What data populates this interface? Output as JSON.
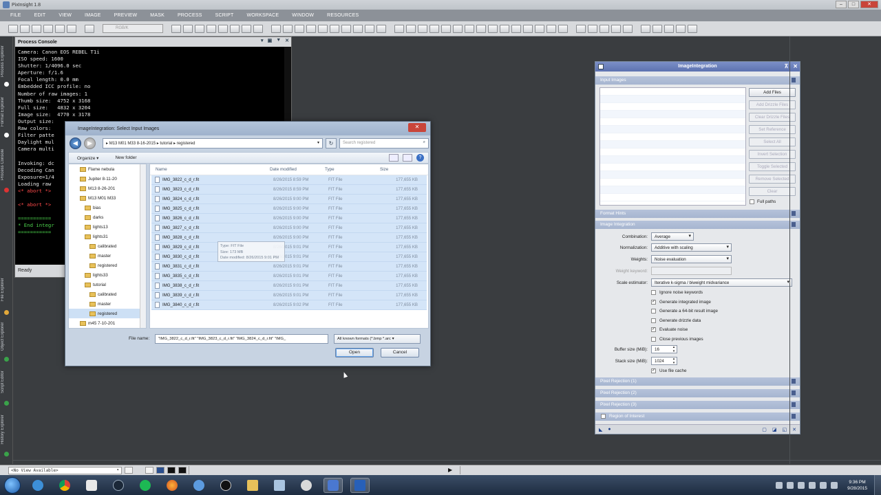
{
  "window": {
    "title": "PixInsight 1.8"
  },
  "menu": [
    "FILE",
    "EDIT",
    "VIEW",
    "IMAGE",
    "PREVIEW",
    "MASK",
    "PROCESS",
    "SCRIPT",
    "WORKSPACE",
    "WINDOW",
    "RESOURCES"
  ],
  "toolbar": {
    "combo_placeholder": "RGB/K"
  },
  "left_tabs": [
    "Process Explorer",
    "Format Explorer",
    "Process Console",
    "File Explorer",
    "Object Explorer",
    "Script Editor",
    "History Explorer"
  ],
  "console": {
    "title": "Process Console",
    "status": "Ready",
    "lines": [
      {
        "t": "Camera: Canon EOS REBEL T1i",
        "c": ""
      },
      {
        "t": "ISO speed: 1600",
        "c": ""
      },
      {
        "t": "Shutter: 1/4096.0 sec",
        "c": ""
      },
      {
        "t": "Aperture: f/1.6",
        "c": ""
      },
      {
        "t": "Focal length: 0.0 mm",
        "c": ""
      },
      {
        "t": "Embedded ICC profile: no",
        "c": ""
      },
      {
        "t": "Number of raw images: 1",
        "c": ""
      },
      {
        "t": "Thumb size:  4752 x 3168",
        "c": ""
      },
      {
        "t": "Full size:   4832 x 3204",
        "c": ""
      },
      {
        "t": "Image size:  4770 x 3178",
        "c": ""
      },
      {
        "t": "Output size:",
        "c": ""
      },
      {
        "t": "Raw colors:",
        "c": ""
      },
      {
        "t": "Filter patte",
        "c": ""
      },
      {
        "t": "Daylight mul",
        "c": ""
      },
      {
        "t": "Camera multi",
        "c": ""
      },
      {
        "t": "",
        "c": ""
      },
      {
        "t": "Invoking: dc",
        "c": ""
      },
      {
        "t": "Decoding Can",
        "c": ""
      },
      {
        "t": "Exposure=1/4",
        "c": ""
      },
      {
        "t": "Loading raw",
        "c": ""
      },
      {
        "t": "<* abort *>",
        "c": "red"
      },
      {
        "t": "",
        "c": ""
      },
      {
        "t": "<* abort *>",
        "c": "red"
      },
      {
        "t": "",
        "c": ""
      },
      {
        "t": "===========",
        "c": "green"
      },
      {
        "t": "* End integr",
        "c": "green"
      },
      {
        "t": "===========",
        "c": "green"
      }
    ]
  },
  "dialog": {
    "title": "ImageIntegration: Select Input Images",
    "address": [
      "M13 M01 M33 8-16-2015",
      "tutorial",
      "registered"
    ],
    "search_placeholder": "Search registered",
    "organize": "Organize ▾",
    "new_folder": "New folder",
    "tree": [
      {
        "label": "Flame nebula",
        "indent": 2
      },
      {
        "label": "Jupiter 8-11-20",
        "indent": 2
      },
      {
        "label": "M13 8-26-201",
        "indent": 2
      },
      {
        "label": "M13 M01 M33",
        "indent": 2
      },
      {
        "label": "bias",
        "indent": 3
      },
      {
        "label": "darks",
        "indent": 3
      },
      {
        "label": "lights13",
        "indent": 3
      },
      {
        "label": "lights31",
        "indent": 3
      },
      {
        "label": "calibrated",
        "indent": 4
      },
      {
        "label": "master",
        "indent": 4
      },
      {
        "label": "registered",
        "indent": 4
      },
      {
        "label": "lights33",
        "indent": 3
      },
      {
        "label": "tutorial",
        "indent": 3
      },
      {
        "label": "calibrated",
        "indent": 4
      },
      {
        "label": "master",
        "indent": 4
      },
      {
        "label": "registered",
        "indent": 4,
        "sel": true
      },
      {
        "label": "m45 7-10-201",
        "indent": 2
      }
    ],
    "columns": [
      "Name",
      "Date modified",
      "Type",
      "Size"
    ],
    "files": [
      {
        "name": "IMG_3822_c_d_r.fit",
        "date": "8/26/2015 8:59 PM",
        "type": "FIT File",
        "size": "177,655 KB"
      },
      {
        "name": "IMG_3823_c_d_r.fit",
        "date": "8/26/2015 8:59 PM",
        "type": "FIT File",
        "size": "177,655 KB"
      },
      {
        "name": "IMG_3824_c_d_r.fit",
        "date": "8/26/2015 9:00 PM",
        "type": "FIT File",
        "size": "177,655 KB"
      },
      {
        "name": "IMG_3825_c_d_r.fit",
        "date": "8/26/2015 9:00 PM",
        "type": "FIT File",
        "size": "177,655 KB"
      },
      {
        "name": "IMG_3826_c_d_r.fit",
        "date": "8/26/2015 9:00 PM",
        "type": "FIT File",
        "size": "177,655 KB"
      },
      {
        "name": "IMG_3827_c_d_r.fit",
        "date": "8/26/2015 9:00 PM",
        "type": "FIT File",
        "size": "177,655 KB"
      },
      {
        "name": "IMG_3828_c_d_r.fit",
        "date": "8/26/2015 9:00 PM",
        "type": "FIT File",
        "size": "177,655 KB"
      },
      {
        "name": "IMG_3829_c_d_r.fit",
        "date": "8/26/2015 9:01 PM",
        "type": "FIT File",
        "size": "177,655 KB"
      },
      {
        "name": "IMG_3830_c_d_r.fit",
        "date": "8/26/2015 9:01 PM",
        "type": "FIT File",
        "size": "177,655 KB"
      },
      {
        "name": "IMG_3831_c_d_r.fit",
        "date": "8/26/2015 9:01 PM",
        "type": "FIT File",
        "size": "177,655 KB"
      },
      {
        "name": "IMG_3835_c_d_r.fit",
        "date": "8/26/2015 9:01 PM",
        "type": "FIT File",
        "size": "177,655 KB"
      },
      {
        "name": "IMG_3838_c_d_r.fit",
        "date": "8/26/2015 9:01 PM",
        "type": "FIT File",
        "size": "177,655 KB"
      },
      {
        "name": "IMG_3839_c_d_r.fit",
        "date": "8/26/2015 9:01 PM",
        "type": "FIT File",
        "size": "177,655 KB"
      },
      {
        "name": "IMG_3840_c_d_r.fit",
        "date": "8/26/2015 9:02 PM",
        "type": "FIT File",
        "size": "177,655 KB"
      }
    ],
    "tooltip": [
      "Type: FIT File",
      "Size: 173 MB",
      "Date modified: 8/26/2015 9:01 PM"
    ],
    "file_name_label": "File name:",
    "file_name_value": "\"IMG_3822_c_d_r.fit\" \"IMG_3823_c_d_r.fit\" \"IMG_3824_c_d_r.fit\" \"IMG_",
    "filter": "All known formats (*.bmp *.arc",
    "open": "Open",
    "cancel": "Cancel"
  },
  "ii": {
    "title": "ImageIntegration",
    "input_images": "Input Images",
    "buttons": [
      "Add Files",
      "Add Drizzle Files",
      "Clear Drizzle Files",
      "Set Reference",
      "Select All",
      "Invert Selection",
      "Toggle Selected",
      "Remove Selected",
      "Clear"
    ],
    "full_paths": "Full paths",
    "format_hints": "Format Hints",
    "image_integration": "Image Integration",
    "combination_label": "Combination:",
    "combination": "Average",
    "normalization_label": "Normalization:",
    "normalization": "Additive with scaling",
    "weights_label": "Weights:",
    "weights": "Noise evaluation",
    "weight_keyword_label": "Weight keyword:",
    "scale_label": "Scale estimator:",
    "scale": "Iterative k-sigma / biweight midvariance",
    "checks": [
      {
        "label": "Ignore noise keywords",
        "on": false
      },
      {
        "label": "Generate integrated image",
        "on": true
      },
      {
        "label": "Generate a 64-bit result image",
        "on": false
      },
      {
        "label": "Generate drizzle data",
        "on": false
      },
      {
        "label": "Evaluate noise",
        "on": true
      },
      {
        "label": "Close previous images",
        "on": false
      }
    ],
    "buffer_label": "Buffer size (MiB):",
    "buffer": "16",
    "stack_label": "Stack size (MiB):",
    "stack": "1024",
    "file_cache": "Use file cache",
    "sections": [
      "Pixel Rejection (1)",
      "Pixel Rejection (2)",
      "Pixel Rejection (3)",
      "Region of Interest"
    ]
  },
  "viewbar": {
    "combo": "<No View Available>"
  },
  "clock": {
    "time": "9:36 PM",
    "date": "9/28/2015"
  }
}
